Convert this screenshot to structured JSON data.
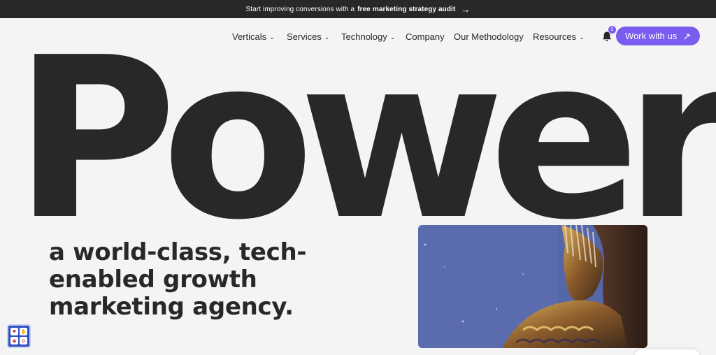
{
  "announcement": {
    "text_before": "Start improving conversions with a",
    "link_text": "free marketing strategy audit",
    "arrow": "→"
  },
  "nav": {
    "items": [
      {
        "label": "Verticals",
        "has_dropdown": true
      },
      {
        "label": "Services",
        "has_dropdown": true
      },
      {
        "label": "Technology",
        "has_dropdown": true
      },
      {
        "label": "Company",
        "has_dropdown": false
      },
      {
        "label": "Our Methodology",
        "has_dropdown": false
      },
      {
        "label": "Resources",
        "has_dropdown": true
      }
    ],
    "notification_count": "2",
    "cta_label": "Work with us",
    "cta_color": "#7b5cf0"
  },
  "hero": {
    "word": "Power",
    "tagline": "a world-class, tech-enabled growth marketing agency."
  },
  "colors": {
    "text": "#2a2827",
    "background": "#f4f4f4",
    "accent": "#7b5cf0"
  }
}
